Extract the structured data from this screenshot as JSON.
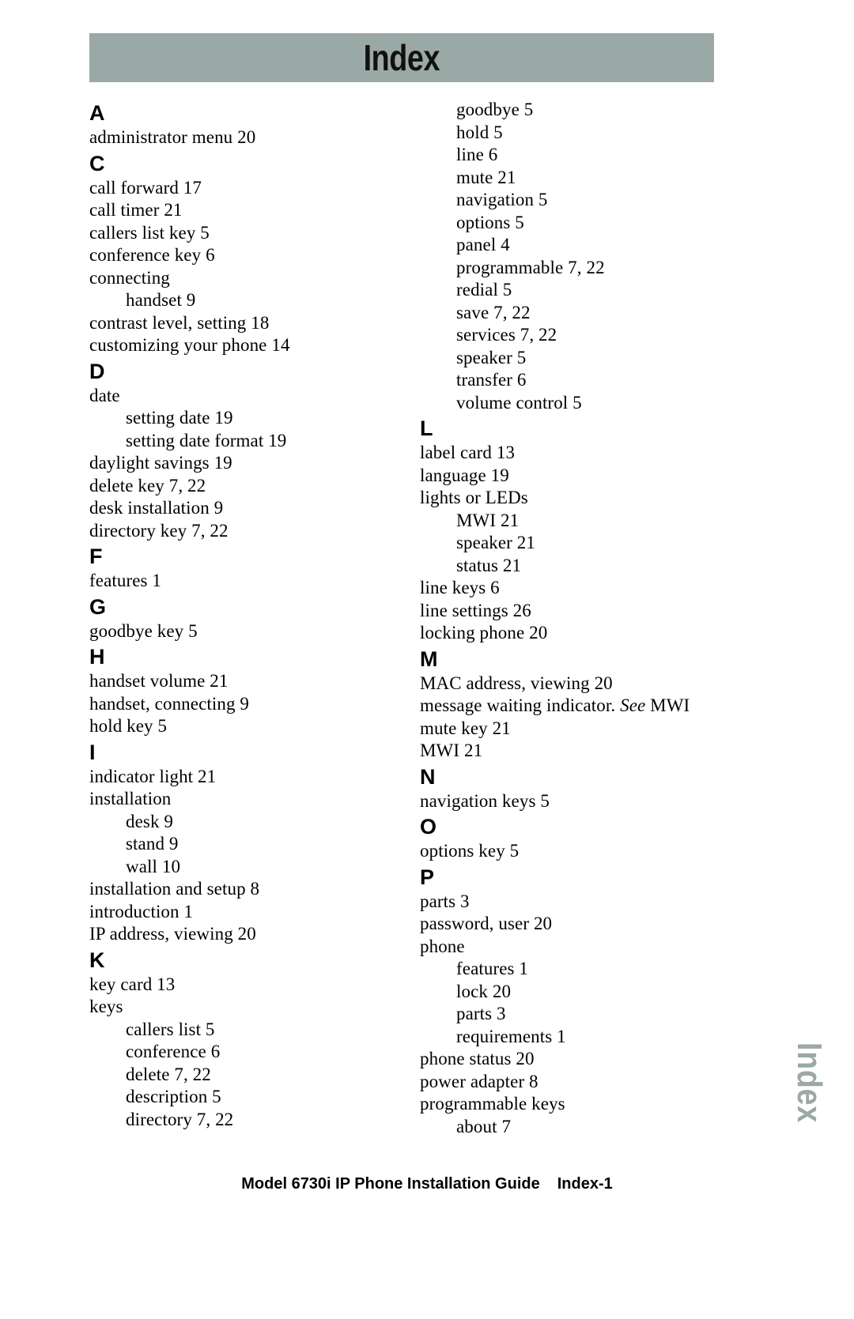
{
  "header": {
    "title": "Index"
  },
  "side_tab": {
    "label": "Index",
    "color": "#9aa9a5"
  },
  "footer": {
    "guide_title": "Model 6730i IP Phone Installation Guide",
    "page_number": "Index-1"
  },
  "columns": {
    "left": [
      {
        "type": "letter",
        "text": "A"
      },
      {
        "type": "entry",
        "level": 1,
        "text": "administrator menu 20"
      },
      {
        "type": "letter",
        "text": "C"
      },
      {
        "type": "entry",
        "level": 1,
        "text": "call forward 17"
      },
      {
        "type": "entry",
        "level": 1,
        "text": "call timer 21"
      },
      {
        "type": "entry",
        "level": 1,
        "text": "callers list key 5"
      },
      {
        "type": "entry",
        "level": 1,
        "text": "conference key 6"
      },
      {
        "type": "entry",
        "level": 1,
        "text": "connecting"
      },
      {
        "type": "entry",
        "level": 2,
        "text": "handset 9"
      },
      {
        "type": "entry",
        "level": 1,
        "text": "contrast level, setting 18"
      },
      {
        "type": "entry",
        "level": 1,
        "text": "customizing your phone 14"
      },
      {
        "type": "letter",
        "text": "D"
      },
      {
        "type": "entry",
        "level": 1,
        "text": "date"
      },
      {
        "type": "entry",
        "level": 2,
        "text": "setting date 19"
      },
      {
        "type": "entry",
        "level": 2,
        "text": "setting date format 19"
      },
      {
        "type": "entry",
        "level": 1,
        "text": "daylight savings 19"
      },
      {
        "type": "entry",
        "level": 1,
        "text": "delete key 7, 22"
      },
      {
        "type": "entry",
        "level": 1,
        "text": "desk installation 9"
      },
      {
        "type": "entry",
        "level": 1,
        "text": "directory key 7, 22"
      },
      {
        "type": "letter",
        "text": "F"
      },
      {
        "type": "entry",
        "level": 1,
        "text": "features 1"
      },
      {
        "type": "letter",
        "text": "G"
      },
      {
        "type": "entry",
        "level": 1,
        "text": "goodbye key 5"
      },
      {
        "type": "letter",
        "text": "H"
      },
      {
        "type": "entry",
        "level": 1,
        "text": "handset volume 21"
      },
      {
        "type": "entry",
        "level": 1,
        "text": "handset, connecting 9"
      },
      {
        "type": "entry",
        "level": 1,
        "text": "hold key 5"
      },
      {
        "type": "letter",
        "text": "I"
      },
      {
        "type": "entry",
        "level": 1,
        "text": "indicator light 21"
      },
      {
        "type": "entry",
        "level": 1,
        "text": "installation"
      },
      {
        "type": "entry",
        "level": 2,
        "text": "desk 9"
      },
      {
        "type": "entry",
        "level": 2,
        "text": "stand 9"
      },
      {
        "type": "entry",
        "level": 2,
        "text": "wall 10"
      },
      {
        "type": "entry",
        "level": 1,
        "text": "installation and setup 8"
      },
      {
        "type": "entry",
        "level": 1,
        "text": "introduction 1"
      },
      {
        "type": "entry",
        "level": 1,
        "text": "IP address, viewing 20"
      },
      {
        "type": "letter",
        "text": "K"
      },
      {
        "type": "entry",
        "level": 1,
        "text": "key card 13"
      },
      {
        "type": "entry",
        "level": 1,
        "text": "keys"
      },
      {
        "type": "entry",
        "level": 2,
        "text": "callers list 5"
      },
      {
        "type": "entry",
        "level": 2,
        "text": "conference 6"
      },
      {
        "type": "entry",
        "level": 2,
        "text": "delete 7, 22"
      },
      {
        "type": "entry",
        "level": 2,
        "text": "description 5"
      },
      {
        "type": "entry",
        "level": 2,
        "text": "directory 7, 22"
      }
    ],
    "right": [
      {
        "type": "entry",
        "level": 2,
        "text": "goodbye 5"
      },
      {
        "type": "entry",
        "level": 2,
        "text": "hold 5"
      },
      {
        "type": "entry",
        "level": 2,
        "text": "line 6"
      },
      {
        "type": "entry",
        "level": 2,
        "text": "mute 21"
      },
      {
        "type": "entry",
        "level": 2,
        "text": "navigation 5"
      },
      {
        "type": "entry",
        "level": 2,
        "text": "options 5"
      },
      {
        "type": "entry",
        "level": 2,
        "text": "panel 4"
      },
      {
        "type": "entry",
        "level": 2,
        "text": "programmable 7, 22"
      },
      {
        "type": "entry",
        "level": 2,
        "text": "redial 5"
      },
      {
        "type": "entry",
        "level": 2,
        "text": "save 7, 22"
      },
      {
        "type": "entry",
        "level": 2,
        "text": "services 7, 22"
      },
      {
        "type": "entry",
        "level": 2,
        "text": "speaker 5"
      },
      {
        "type": "entry",
        "level": 2,
        "text": "transfer 6"
      },
      {
        "type": "entry",
        "level": 2,
        "text": "volume control 5"
      },
      {
        "type": "letter",
        "text": "L"
      },
      {
        "type": "entry",
        "level": 1,
        "text": "label card 13"
      },
      {
        "type": "entry",
        "level": 1,
        "text": "language 19"
      },
      {
        "type": "entry",
        "level": 1,
        "text": "lights or LEDs"
      },
      {
        "type": "entry",
        "level": 2,
        "text": "MWI 21"
      },
      {
        "type": "entry",
        "level": 2,
        "text": "speaker 21"
      },
      {
        "type": "entry",
        "level": 2,
        "text": "status 21"
      },
      {
        "type": "entry",
        "level": 1,
        "text": "line keys 6"
      },
      {
        "type": "entry",
        "level": 1,
        "text": "line settings 26"
      },
      {
        "type": "entry",
        "level": 1,
        "text": "locking phone 20"
      },
      {
        "type": "letter",
        "text": "M"
      },
      {
        "type": "entry",
        "level": 1,
        "text": "MAC address, viewing 20"
      },
      {
        "type": "entry",
        "level": 1,
        "text": "message waiting indicator. See MWI",
        "italic_word": "See"
      },
      {
        "type": "entry",
        "level": 1,
        "text": "mute key 21"
      },
      {
        "type": "entry",
        "level": 1,
        "text": "MWI 21"
      },
      {
        "type": "letter",
        "text": "N"
      },
      {
        "type": "entry",
        "level": 1,
        "text": "navigation keys 5"
      },
      {
        "type": "letter",
        "text": "O"
      },
      {
        "type": "entry",
        "level": 1,
        "text": "options key 5"
      },
      {
        "type": "letter",
        "text": "P"
      },
      {
        "type": "entry",
        "level": 1,
        "text": "parts 3"
      },
      {
        "type": "entry",
        "level": 1,
        "text": "password, user 20"
      },
      {
        "type": "entry",
        "level": 1,
        "text": "phone"
      },
      {
        "type": "entry",
        "level": 2,
        "text": "features 1"
      },
      {
        "type": "entry",
        "level": 2,
        "text": "lock 20"
      },
      {
        "type": "entry",
        "level": 2,
        "text": "parts 3"
      },
      {
        "type": "entry",
        "level": 2,
        "text": "requirements 1"
      },
      {
        "type": "entry",
        "level": 1,
        "text": "phone status 20"
      },
      {
        "type": "entry",
        "level": 1,
        "text": "power adapter 8"
      },
      {
        "type": "entry",
        "level": 1,
        "text": "programmable keys"
      },
      {
        "type": "entry",
        "level": 2,
        "text": "about 7"
      }
    ]
  }
}
